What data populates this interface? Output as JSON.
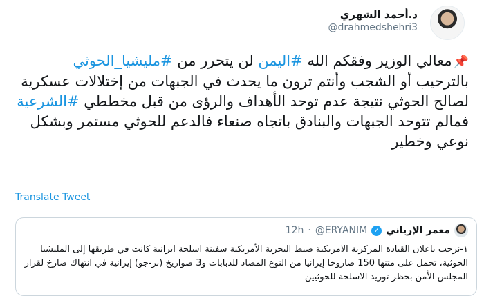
{
  "author": {
    "display_name": "د.أحمد الشهري",
    "handle": "@drahmedshehri3"
  },
  "tweet": {
    "pin_icon": "pushpin-icon",
    "seg1": "معالي الوزير وفقكم الله ",
    "tag1": "#اليمن",
    "seg2": " لن يتحرر من ",
    "tag2": "#مليشيا_الحوثي",
    "seg3": " بالترحيب أو الشجب وأنتم ترون ما يحدث في الجبهات من إختلالات عسكرية لصالح الحوثي نتيجة عدم توحد الأهداف والرؤى من قبل مخططي ",
    "tag3": "#الشرعية",
    "seg4": " فمالم تتوحد الجبهات والبنادق باتجاه صنعاء فالدعم للحوثي مستمر وبشكل نوعي وخطير",
    "hashtag_color": "#1b95e0"
  },
  "translate_label": "Translate Tweet",
  "quoted": {
    "name": "معمر الإرياني",
    "handle": "@ERYANIM",
    "separator": "·",
    "time": "12h",
    "text": "١-نرحب باعلان القيادة المركزية الامريكية ضبط البحرية الأمريكية سفينة اسلحة ايرانية كانت في طريقها إلى المليشيا الحوثية، تحمل على متنها 150 صاروخا إيرانيا من النوع المضاد للدبابات و3 صواريخ (بر-جو) إيرانية في انتهاك صارخ لقرار المجلس الأمن بحظر توريد الاسلحة للحوثيين"
  }
}
